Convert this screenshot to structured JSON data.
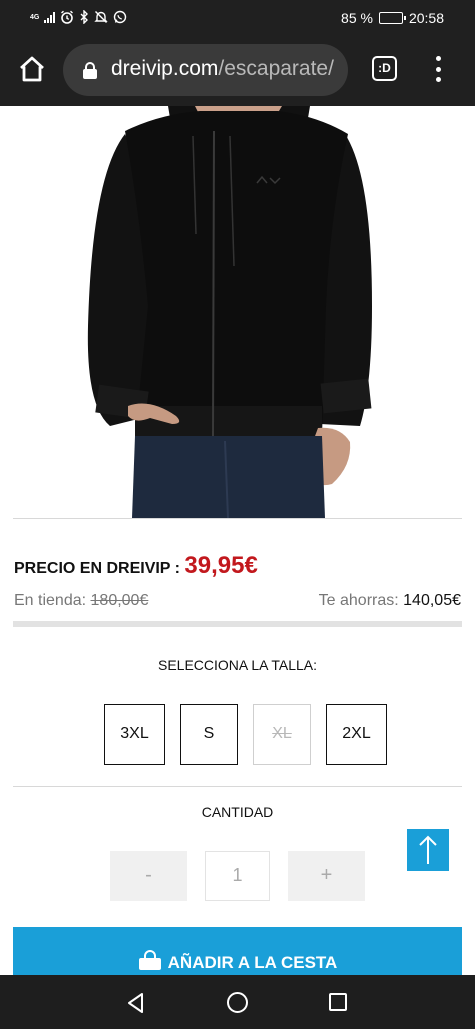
{
  "status_bar": {
    "network": "4G",
    "battery_percent": "85 %",
    "battery_level": 0.85,
    "time": "20:58",
    "icons": [
      "signal-icon",
      "alarm-icon",
      "bluetooth-icon",
      "mute-icon",
      "whatsapp-icon",
      "battery-icon"
    ]
  },
  "browser": {
    "domain": "dreivip.com",
    "path": "/escaparate/",
    "tab_switcher_label": ":D",
    "icons": [
      "home-icon",
      "lock-icon",
      "tab-switcher-icon",
      "more-menu-icon"
    ]
  },
  "product": {
    "image": "black-zip-hoodie",
    "price_label": "PRECIO EN DREIVIP :",
    "price": "39,95€",
    "store_label": "En tienda:",
    "store_price": "180,00€",
    "savings_label": "Te ahorras:",
    "savings": "140,05€"
  },
  "sizes": {
    "title": "SELECCIONA LA TALLA:",
    "options": [
      {
        "label": "3XL",
        "available": true
      },
      {
        "label": "S",
        "available": true
      },
      {
        "label": "XL",
        "available": false
      },
      {
        "label": "2XL",
        "available": true
      }
    ]
  },
  "quantity": {
    "title": "CANTIDAD",
    "minus": "-",
    "value": "1",
    "plus": "+"
  },
  "cart": {
    "label": "AÑADIR A LA CESTA",
    "icon": "shopping-bag-icon"
  },
  "colors": {
    "accent": "#1a9fd8",
    "price": "#c2181d",
    "system_bar": "#202020"
  },
  "nav_icons": [
    "back-icon",
    "home-circle-icon",
    "recent-apps-icon",
    "scroll-to-top-icon"
  ]
}
